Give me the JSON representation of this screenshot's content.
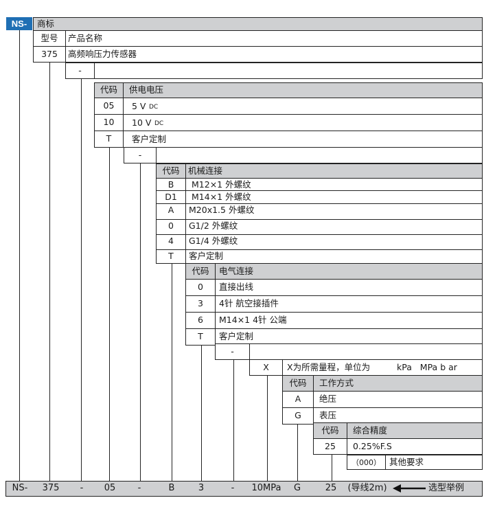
{
  "logo": "NS-",
  "brand_header": "商标",
  "model": {
    "header_code": "型号",
    "header_name": "产品名称",
    "code": "375",
    "name": "高频响压力传感器"
  },
  "sep1": "-",
  "supply": {
    "header_code": "代码",
    "header_name": "供电电压",
    "rows": [
      {
        "code": "05",
        "desc": "5 V",
        "sub": "DC"
      },
      {
        "code": "10",
        "desc": "10 V",
        "sub": "DC"
      },
      {
        "code": "T",
        "desc": "客户定制",
        "sub": ""
      }
    ]
  },
  "sep2": "-",
  "mech": {
    "header_code": "代码",
    "header_name": "机械连接",
    "rows": [
      {
        "code": "B",
        "desc": "M12×1 外螺纹"
      },
      {
        "code": "D1",
        "desc": "M14×1 外螺纹"
      },
      {
        "code": "A",
        "desc": "M20x1.5 外螺纹"
      },
      {
        "code": "0",
        "desc": "G1/2 外螺纹"
      },
      {
        "code": "4",
        "desc": "G1/4 外螺纹"
      },
      {
        "code": "T",
        "desc": "客户定制"
      }
    ]
  },
  "elec": {
    "header_code": "代码",
    "header_name": "电气连接",
    "rows": [
      {
        "code": "0",
        "desc": "直接出线"
      },
      {
        "code": "3",
        "desc": "4针 航空接插件"
      },
      {
        "code": "6",
        "desc": "M14×1 4针 公端"
      },
      {
        "code": "T",
        "desc": "客户定制"
      }
    ]
  },
  "sep3": "-",
  "range": {
    "code": "X",
    "desc": "X为所需量程，单位为",
    "units": "kPa   MPa b ar"
  },
  "mode": {
    "header_code": "代码",
    "header_name": "工作方式",
    "rows": [
      {
        "code": "A",
        "desc": "绝压"
      },
      {
        "code": "G",
        "desc": "表压"
      }
    ]
  },
  "accuracy": {
    "header_code": "代码",
    "header_name": "综合精度",
    "rows": [
      {
        "code": "25",
        "desc": "0.25%F.S"
      }
    ],
    "other_code": "（000）",
    "other_desc": "其他要求"
  },
  "example": {
    "items": [
      "NS-",
      "375",
      "-",
      "05",
      "-",
      "B",
      "3",
      "-",
      "10MPa",
      "G",
      "25",
      "(导线2m)"
    ],
    "arrow_label": "选型举例"
  }
}
